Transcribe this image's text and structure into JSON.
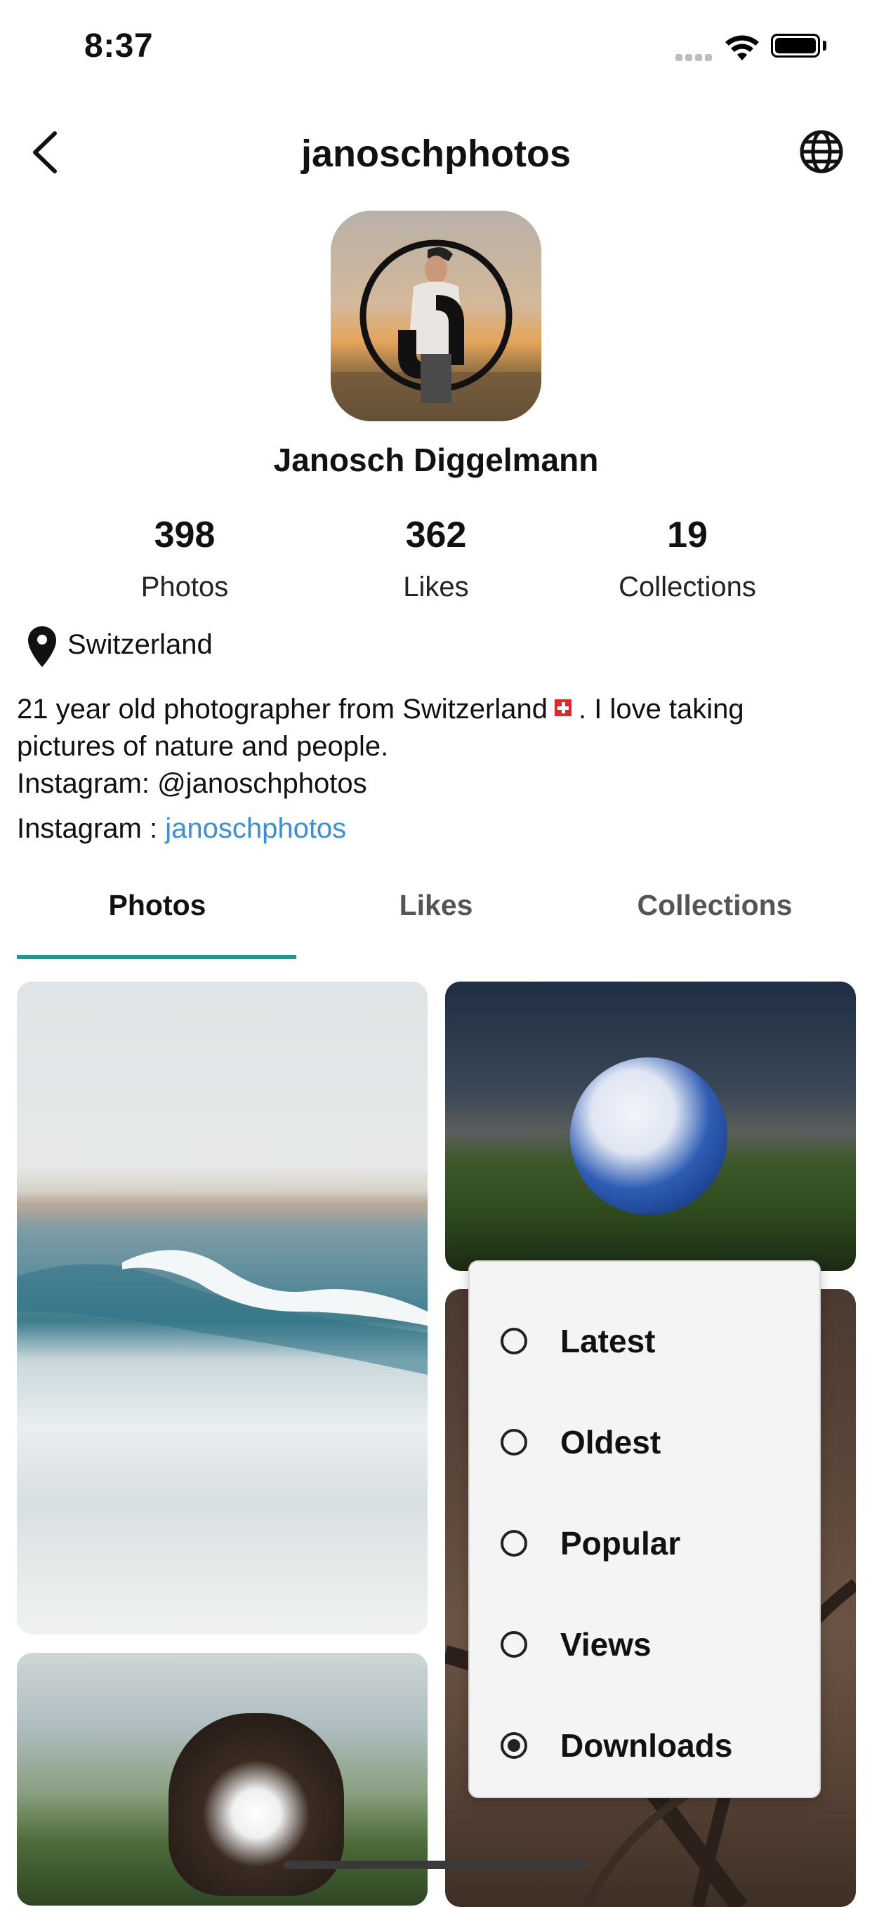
{
  "status_bar": {
    "time": "8:37"
  },
  "header": {
    "title": "janoschphotos"
  },
  "profile": {
    "name": "Janosch Diggelmann",
    "stats": [
      {
        "value": "398",
        "label": "Photos"
      },
      {
        "value": "362",
        "label": "Likes"
      },
      {
        "value": "19",
        "label": "Collections"
      }
    ],
    "location": "Switzerland",
    "bio_line1": "21 year old photographer from Switzerland",
    "bio_line1_end": ". I love taking",
    "bio_line2": "pictures of nature and people.",
    "bio_line3": "Instagram: @janoschphotos",
    "instagram_label": "Instagram : ",
    "instagram_handle": "janoschphotos"
  },
  "tabs": [
    {
      "label": "Photos",
      "active": true
    },
    {
      "label": "Likes",
      "active": false
    },
    {
      "label": "Collections",
      "active": false
    }
  ],
  "sort_menu": {
    "options": [
      {
        "label": "Latest",
        "selected": false
      },
      {
        "label": "Oldest",
        "selected": false
      },
      {
        "label": "Popular",
        "selected": false
      },
      {
        "label": "Views",
        "selected": false
      },
      {
        "label": "Downloads",
        "selected": true
      }
    ]
  },
  "colors": {
    "accent": "#1b9a8f",
    "link": "#3a8fd6"
  }
}
